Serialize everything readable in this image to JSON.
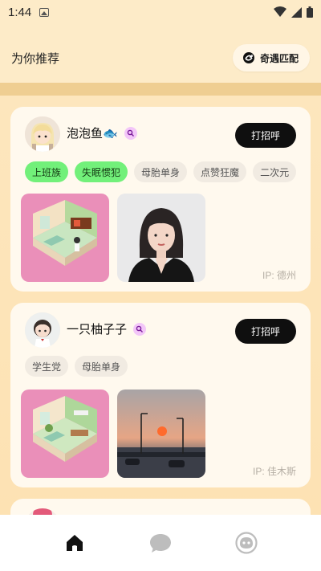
{
  "status": {
    "time": "1:44"
  },
  "header": {
    "title": "为你推荐",
    "match_label": "奇遇匹配"
  },
  "cards": [
    {
      "name": "泡泡鱼🐟",
      "greet_label": "打招呼",
      "tags": [
        {
          "label": "上班族",
          "highlighted": true
        },
        {
          "label": "失眠惯犯",
          "highlighted": true
        },
        {
          "label": "母胎单身",
          "highlighted": false
        },
        {
          "label": "点赞狂魔",
          "highlighted": false
        },
        {
          "label": "二次元",
          "highlighted": false
        }
      ],
      "ip": "IP: 德州"
    },
    {
      "name": "一只柚子子",
      "greet_label": "打招呼",
      "tags": [
        {
          "label": "学生党",
          "highlighted": false
        },
        {
          "label": "母胎单身",
          "highlighted": false
        }
      ],
      "ip": "IP: 佳木斯"
    }
  ],
  "nav": {
    "items": [
      "home-icon",
      "chat-icon",
      "profile-icon"
    ]
  },
  "colors": {
    "accent": "#72f07a",
    "background": "#fdebc8",
    "button": "#0f0f0f"
  }
}
